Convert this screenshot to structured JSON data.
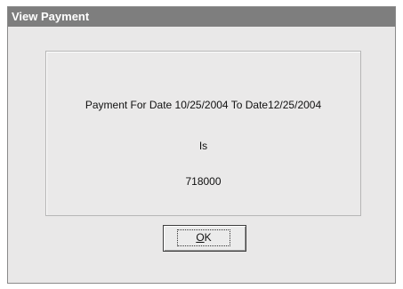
{
  "dialog": {
    "title": "View Payment",
    "message_line1": "Payment For Date 10/25/2004 To Date12/25/2004",
    "message_line2": "Is",
    "amount": "718000"
  },
  "buttons": {
    "ok_underlined": "O",
    "ok_rest": "K"
  }
}
